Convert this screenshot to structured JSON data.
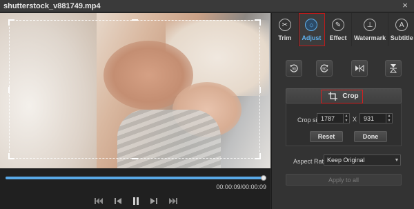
{
  "window": {
    "title": "shutterstock_v881749.mp4",
    "close_symbol": "×"
  },
  "player": {
    "progress_percent": 100,
    "time_display": "00:00:09/00:00:09",
    "controls": [
      "skip-back-icon",
      "prev-frame-icon",
      "pause-icon",
      "next-frame-icon",
      "skip-forward-icon"
    ]
  },
  "tabs": [
    {
      "label": "Trim",
      "icon": "scissors-icon",
      "active": false
    },
    {
      "label": "Adjust",
      "icon": "brightness-icon",
      "active": true
    },
    {
      "label": "Effect",
      "icon": "wand-icon",
      "active": false
    },
    {
      "label": "Watermark",
      "icon": "watermark-icon",
      "active": false
    },
    {
      "label": "Subtitle",
      "icon": "subtitle-icon",
      "active": false
    }
  ],
  "rotate_buttons": [
    {
      "name": "rotate-left-90-icon",
      "label": "90"
    },
    {
      "name": "rotate-right-90-icon",
      "label": "90"
    },
    {
      "name": "flip-horizontal-icon"
    },
    {
      "name": "flip-vertical-icon"
    }
  ],
  "crop": {
    "header_label": "Crop",
    "size_label": "Crop size:",
    "width": "1787",
    "separator": "X",
    "height": "931",
    "reset_label": "Reset",
    "done_label": "Done"
  },
  "aspect": {
    "label": "Aspect Ratio:",
    "value": "Keep Original"
  },
  "apply_label": "Apply to all",
  "colors": {
    "accent": "#5fb1ee",
    "highlight_red": "#d42020",
    "progress": "#59a9e8"
  }
}
